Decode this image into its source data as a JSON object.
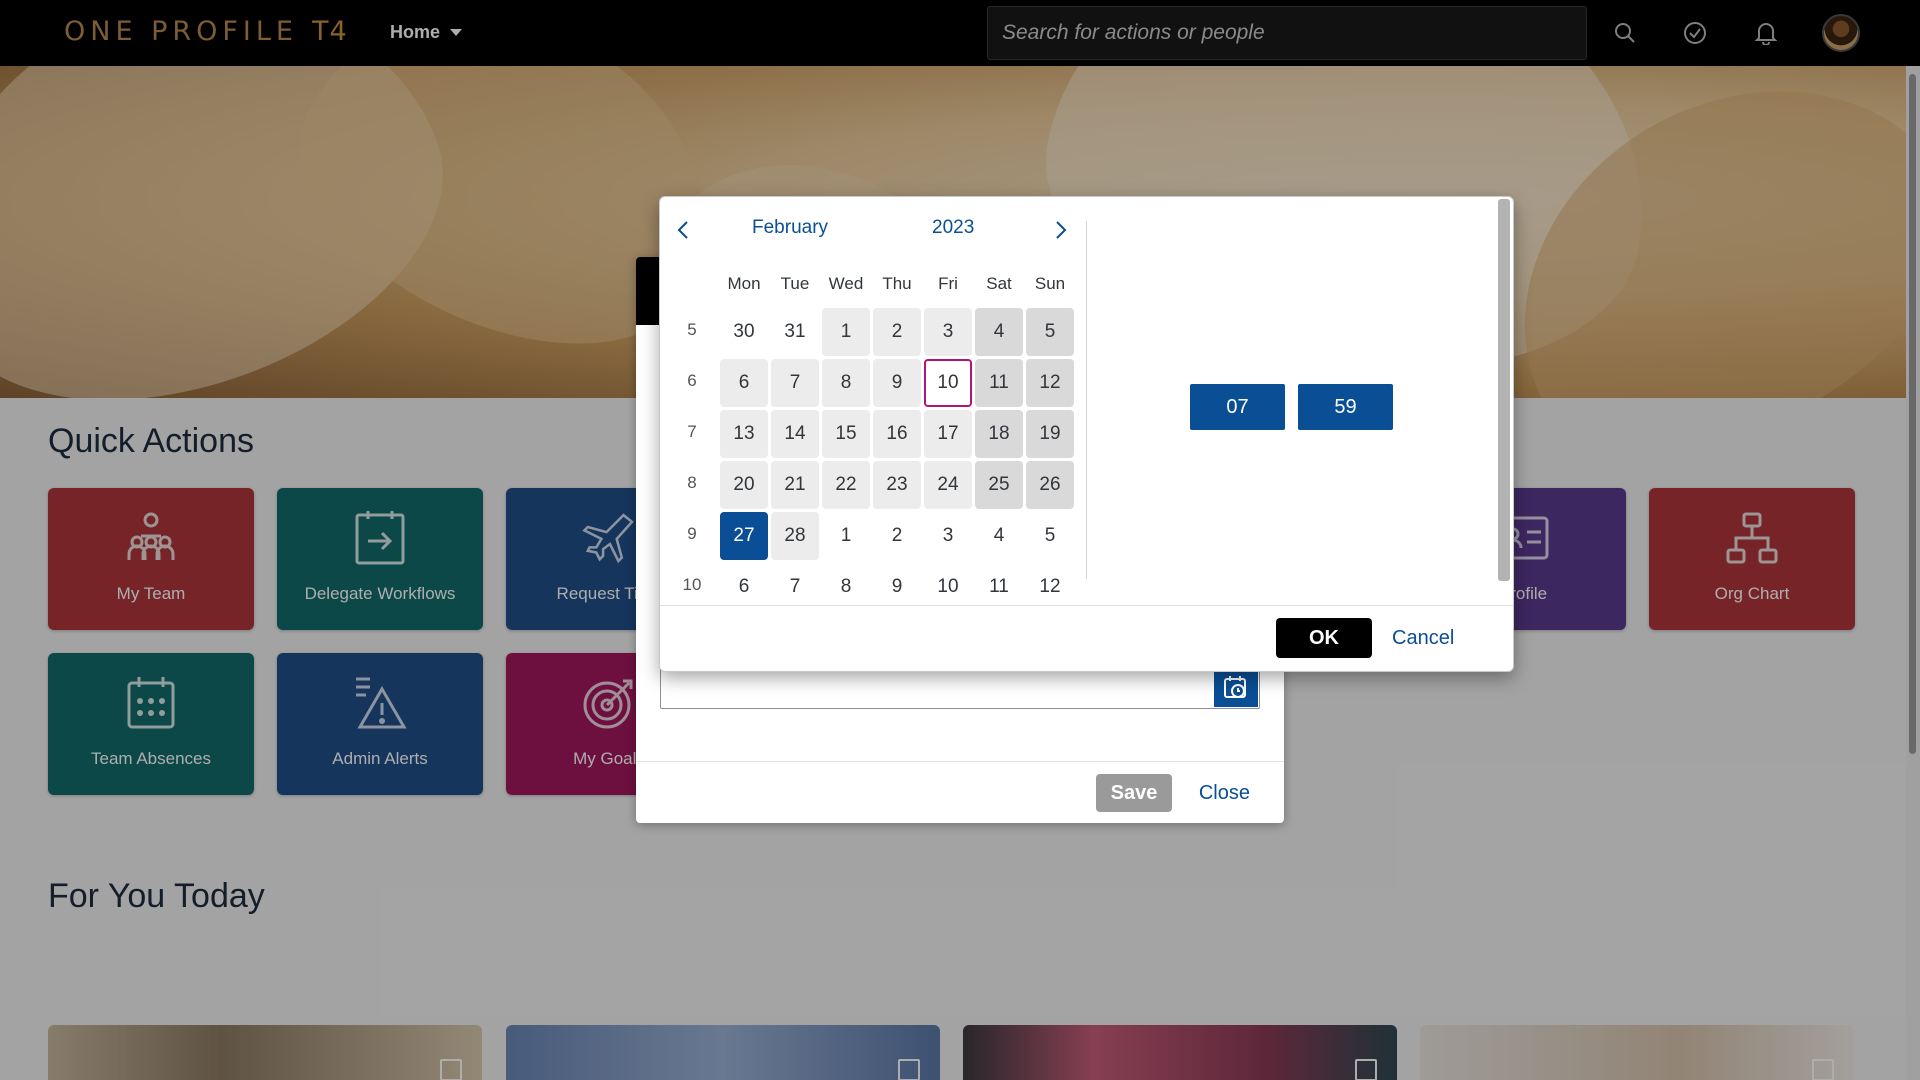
{
  "shell": {
    "logo": "ONE PROFILE",
    "logo_suffix": "T4",
    "home_label": "Home",
    "search_placeholder": "Search for actions or people",
    "icons": [
      "search-icon",
      "task-check-icon",
      "bell-icon",
      "avatar"
    ]
  },
  "sections": {
    "quick_actions": "Quick Actions",
    "for_you_today": "For You Today"
  },
  "tiles": [
    {
      "label": "My Team",
      "icon": "team-icon",
      "color": "#b0353d"
    },
    {
      "label": "Delegate Workflows",
      "icon": "delegate-icon",
      "color": "#126b6b"
    },
    {
      "label": "Request Time",
      "icon": "airplane-icon",
      "color": "#1f4f8a"
    },
    {
      "label": "Profile",
      "icon": "profile-card-icon",
      "color": "#5b3a8e"
    },
    {
      "label": "Org Chart",
      "icon": "org-chart-icon",
      "color": "#b0353d"
    },
    {
      "label": "Team Absences",
      "icon": "calendar-icon",
      "color": "#126b6b"
    },
    {
      "label": "Admin Alerts",
      "icon": "alert-icon",
      "color": "#1f4f8a"
    },
    {
      "label": "My Goals",
      "icon": "target-icon",
      "color": "#a3185e"
    }
  ],
  "dialog": {
    "save_label": "Save",
    "close_label": "Close"
  },
  "picker": {
    "month": "February",
    "year": "2023",
    "weekdays": [
      "Mon",
      "Tue",
      "Wed",
      "Thu",
      "Fri",
      "Sat",
      "Sun"
    ],
    "weeks": [
      {
        "num": "5",
        "days": [
          "30",
          "31",
          "1",
          "2",
          "3",
          "4",
          "5"
        ]
      },
      {
        "num": "6",
        "days": [
          "6",
          "7",
          "8",
          "9",
          "10",
          "11",
          "12"
        ]
      },
      {
        "num": "7",
        "days": [
          "13",
          "14",
          "15",
          "16",
          "17",
          "18",
          "19"
        ]
      },
      {
        "num": "8",
        "days": [
          "20",
          "21",
          "22",
          "23",
          "24",
          "25",
          "26"
        ]
      },
      {
        "num": "9",
        "days": [
          "27",
          "28",
          "1",
          "2",
          "3",
          "4",
          "5"
        ]
      },
      {
        "num": "10",
        "days": [
          "6",
          "7",
          "8",
          "9",
          "10",
          "11",
          "12"
        ]
      }
    ],
    "today": "10",
    "selected": "27",
    "hour": "07",
    "minute": "59",
    "ok_label": "OK",
    "cancel_label": "Cancel"
  },
  "colors": {
    "accent": "#0a4f95",
    "today_border": "#b0167a",
    "shell_bg": "#000000"
  }
}
